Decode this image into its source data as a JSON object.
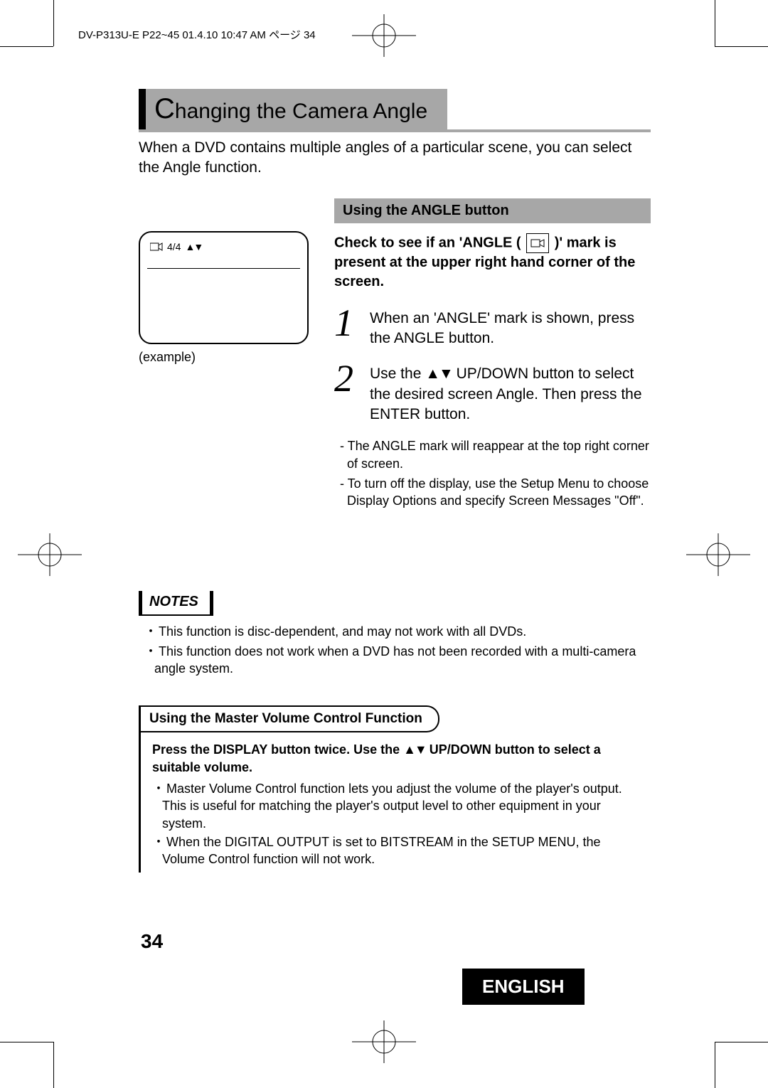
{
  "header": "DV-P313U-E P22~45  01.4.10 10:47 AM  ページ 34",
  "title_prefix": "C",
  "title_rest": "hanging the Camera Angle",
  "intro": "When a DVD contains multiple angles of a particular scene, you can select the Angle function.",
  "example": {
    "count": "4/4",
    "arrows": "▲▼",
    "caption": "(example)"
  },
  "angle": {
    "subheading": "Using the ANGLE button",
    "check_pre": "Check to see if an 'ANGLE (",
    "check_post": ")' mark is present at the upper right hand corner of the screen.",
    "step1_num": "1",
    "step1": "When an 'ANGLE' mark is shown, press the ANGLE button.",
    "step2_num": "2",
    "step2_pre": "Use the ",
    "step2_arrows": "▲▼",
    "step2_post": " UP/DOWN button to select the desired screen Angle. Then press the ENTER button.",
    "dash1": "- The ANGLE mark will reappear at the top right corner of screen.",
    "dash2": "- To turn off the display, use the Setup Menu to choose Display Options and specify Screen Messages \"Off\"."
  },
  "notes": {
    "label": "NOTES",
    "n1": "This function is disc-dependent, and may not work with all DVDs.",
    "n2": "This function does not work when a DVD has not been recorded with a multi-camera angle system."
  },
  "volume": {
    "heading": "Using the Master Volume Control Function",
    "lead_pre": "Press the DISPLAY button twice. Use the ",
    "lead_arrows": "▲▼",
    "lead_post": " UP/DOWN button to select a suitable volume.",
    "b1": "Master Volume Control function lets you adjust the volume of the player's output. This is useful for matching the player's output level to other equipment in your system.",
    "b2": "When the  DIGITAL OUTPUT is set to BITSTREAM in the SETUP MENU, the Volume Control function will not work."
  },
  "page_number": "34",
  "language": "ENGLISH"
}
